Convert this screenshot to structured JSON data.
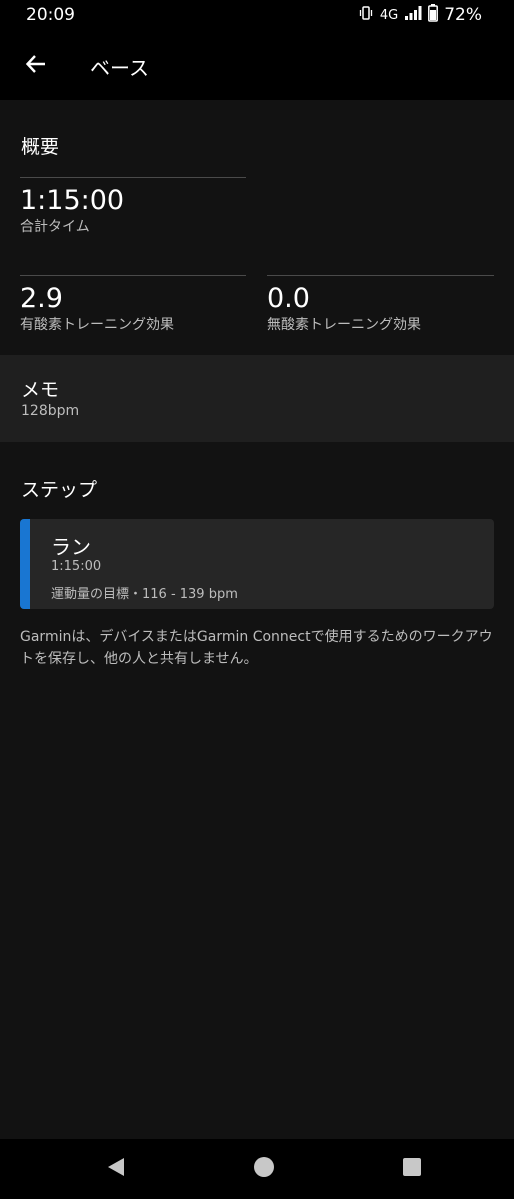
{
  "status_bar": {
    "time": "20:09",
    "network": "4G",
    "battery": "72%"
  },
  "header": {
    "title": "ベース",
    "back_icon": "arrow-left-icon"
  },
  "summary": {
    "title": "概要",
    "total_time": {
      "value": "1:15:00",
      "label": "合計タイム"
    },
    "aerobic": {
      "value": "2.9",
      "label": "有酸素トレーニング効果"
    },
    "anaerobic": {
      "value": "0.0",
      "label": "無酸素トレーニング効果"
    }
  },
  "memo": {
    "title": "メモ",
    "value": "128bpm"
  },
  "steps": {
    "title": "ステップ",
    "items": [
      {
        "name": "ラン",
        "duration": "1:15:00",
        "target": "運動量の目標・116 - 139 bpm"
      }
    ]
  },
  "disclaimer": "Garminは、デバイスまたはGarmin Connectで使用するためのワークアウトを保存し、他の人と共有しません。",
  "colors": {
    "background": "#121212",
    "header": "#000000",
    "memo_bg": "#1f1f1f",
    "card_bg": "#262626",
    "accent": "#1976d2"
  }
}
